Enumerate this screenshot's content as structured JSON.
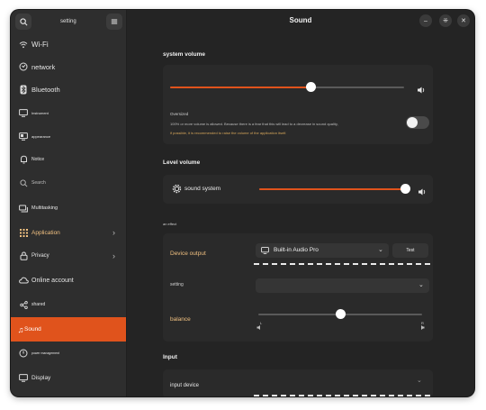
{
  "header": {
    "title": "Sound"
  },
  "sidebar": {
    "title": "setting",
    "items": [
      {
        "label": "Wi-Fi",
        "icon": "wifi-icon"
      },
      {
        "label": "network",
        "icon": "network-icon"
      },
      {
        "label": "Bluetooth",
        "icon": "bluetooth-icon"
      },
      {
        "label": "Instrument",
        "icon": "monitor-icon"
      },
      {
        "label": "appearance",
        "icon": "display-icon"
      },
      {
        "label": "Notice",
        "icon": "bell-icon"
      },
      {
        "label": "Search",
        "icon": "search-icon"
      },
      {
        "label": "Multitasking",
        "icon": "multitasking-icon"
      },
      {
        "label": "Application",
        "icon": "grid-icon"
      },
      {
        "label": "Privacy",
        "icon": "lock-icon"
      },
      {
        "label": "Online account",
        "icon": "cloud-icon"
      },
      {
        "label": "shared",
        "icon": "share-icon"
      },
      {
        "label": "Sound",
        "icon": "music-icon"
      },
      {
        "label": "power management",
        "icon": "power-icon"
      },
      {
        "label": "Display",
        "icon": "display-icon"
      }
    ]
  },
  "system_volume": {
    "title": "system volume",
    "level": 0.6,
    "oversized_label": "Oversized",
    "oversized_desc1": "100% or more volume is allowed. Because there is a fear that this will lead to a decrease in sound quality,",
    "oversized_desc2": "if possible, it is recommended to raise the volume of the application itself.",
    "oversized_enabled": false
  },
  "level_volume": {
    "title": "Level volume",
    "label": "sound system",
    "level": 1.0
  },
  "output": {
    "section_label": "an effect",
    "device_output_label": "Device output",
    "device_value": "Built-in Audio Pro",
    "test_label": "Test",
    "setting_label": "setting",
    "setting_value": "",
    "balance_label": "balance",
    "balance": 0.5,
    "balance_left": "L",
    "balance_right": "R"
  },
  "input": {
    "title": "Input",
    "device_label": "input device"
  },
  "colors": {
    "accent": "#e0531c",
    "window": "#242424",
    "sidebar": "#2e2e2e",
    "card": "#2a2a2a"
  }
}
